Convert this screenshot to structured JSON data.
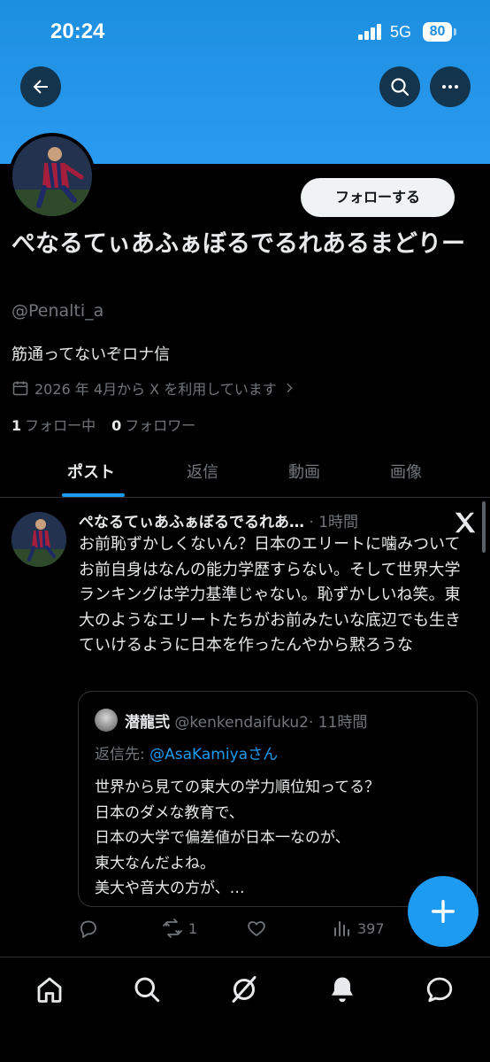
{
  "status_bar": {
    "time": "20:24",
    "network": "5G",
    "battery": "80"
  },
  "profile": {
    "follow_button": "フォローする",
    "display_name": "ぺなるてぃあふぁぼるでるれあるまどりー",
    "handle": "@Penalti_a",
    "bio": "筋通ってないぞロナ信",
    "joined": "2026 年 4月から X を利用しています",
    "following_count": "1",
    "following_label": "フォロー中",
    "followers_count": "0",
    "followers_label": "フォロワー"
  },
  "tabs": [
    "ポスト",
    "返信",
    "動画",
    "画像"
  ],
  "post": {
    "author_name": "ぺなるてぃあふぁぼるでるれあ…",
    "time": "· 1時間",
    "text": "お前恥ずかしくないん？日本のエリートに噛みついてお前自身はなんの能力学歴すらない。そして世界大学ランキングは学力基準じゃない。恥ずかしいね笑。東大のようなエリートたちがお前みたいな底辺でも生きていけるように日本を作ったんやから黙ろうな",
    "quote": {
      "author_name": "潜龍弐",
      "author_handle": "@kenkendaifuku2",
      "time": "· 11時間",
      "reply_prefix": "返信先:",
      "reply_to": "@AsaKamiyaさん",
      "text_lines": [
        "世界から見ての東大の学力順位知ってる？",
        "日本のダメな教育で、",
        "日本の大学で偏差値が日本一なのが、",
        "東大なんだよね。",
        "美大や音大の方が、…"
      ]
    },
    "actions": {
      "replies": "",
      "reposts": "1",
      "likes": "",
      "views": "397"
    }
  },
  "colors": {
    "accent": "#1d9bf0",
    "banner": "#1d8fe0",
    "background": "#000000",
    "muted": "#71767b"
  },
  "icons": [
    "back-arrow-icon",
    "search-icon",
    "more-icon",
    "calendar-icon",
    "chevron-right-icon",
    "x-logo-icon",
    "reply-icon",
    "repost-icon",
    "like-icon",
    "views-icon",
    "compose-icon",
    "home-icon",
    "explore-icon",
    "grok-icon",
    "notifications-icon",
    "messages-icon"
  ]
}
